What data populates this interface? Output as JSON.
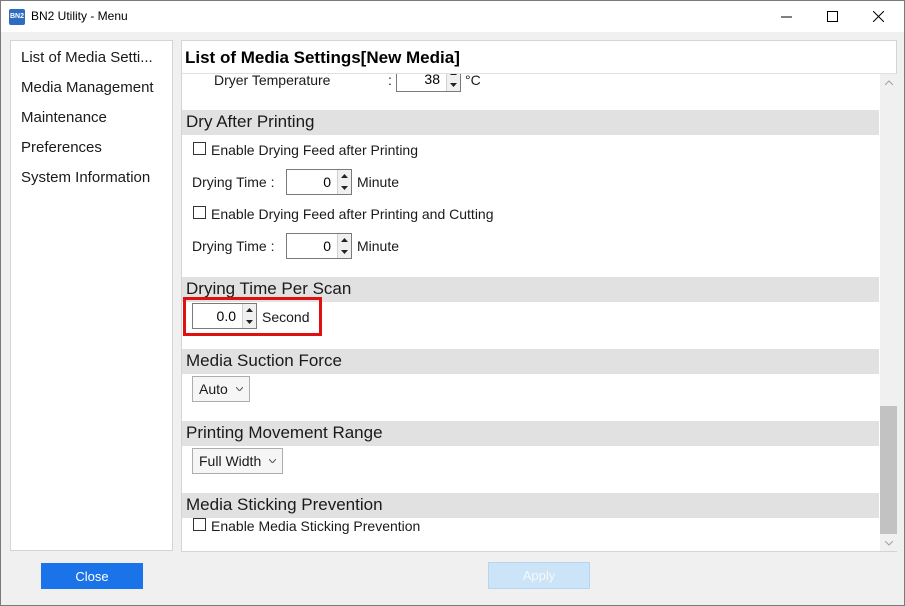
{
  "window": {
    "app_icon_text": "BN2",
    "title": "BN2 Utility - Menu"
  },
  "sidebar": {
    "items": [
      {
        "label": "List of Media Setti..."
      },
      {
        "label": "Media Management"
      },
      {
        "label": "Maintenance"
      },
      {
        "label": "Preferences"
      },
      {
        "label": "System Information"
      }
    ],
    "close_label": "Close"
  },
  "main": {
    "title": "List of Media Settings[New Media]",
    "dryer_temperature": {
      "label": "Dryer Temperature",
      "colon": ":",
      "value": "38",
      "unit": "°C"
    },
    "dry_after_printing": {
      "header": "Dry After Printing",
      "feed_after_printing": {
        "label": "Enable Drying Feed after Printing",
        "checked": false
      },
      "drying_time_1": {
        "label": "Drying Time :",
        "value": "0",
        "unit": "Minute"
      },
      "feed_after_printing_cutting": {
        "label": "Enable Drying Feed after Printing and Cutting",
        "checked": false
      },
      "drying_time_2": {
        "label": "Drying Time :",
        "value": "0",
        "unit": "Minute"
      }
    },
    "drying_time_per_scan": {
      "header": "Drying Time Per Scan",
      "value": "0.0",
      "unit": "Second"
    },
    "media_suction_force": {
      "header": "Media Suction Force",
      "selected": "Auto"
    },
    "printing_movement_range": {
      "header": "Printing Movement Range",
      "selected": "Full Width"
    },
    "media_sticking_prevention": {
      "header": "Media Sticking Prevention",
      "checkbox": {
        "label": "Enable Media Sticking Prevention",
        "checked": false
      }
    },
    "apply_label": "Apply"
  },
  "colors": {
    "accent": "#1a73e8",
    "section_header_bg": "#e1e1e1",
    "highlight_border": "#e01010",
    "apply_disabled_bg": "#cce4f7"
  }
}
